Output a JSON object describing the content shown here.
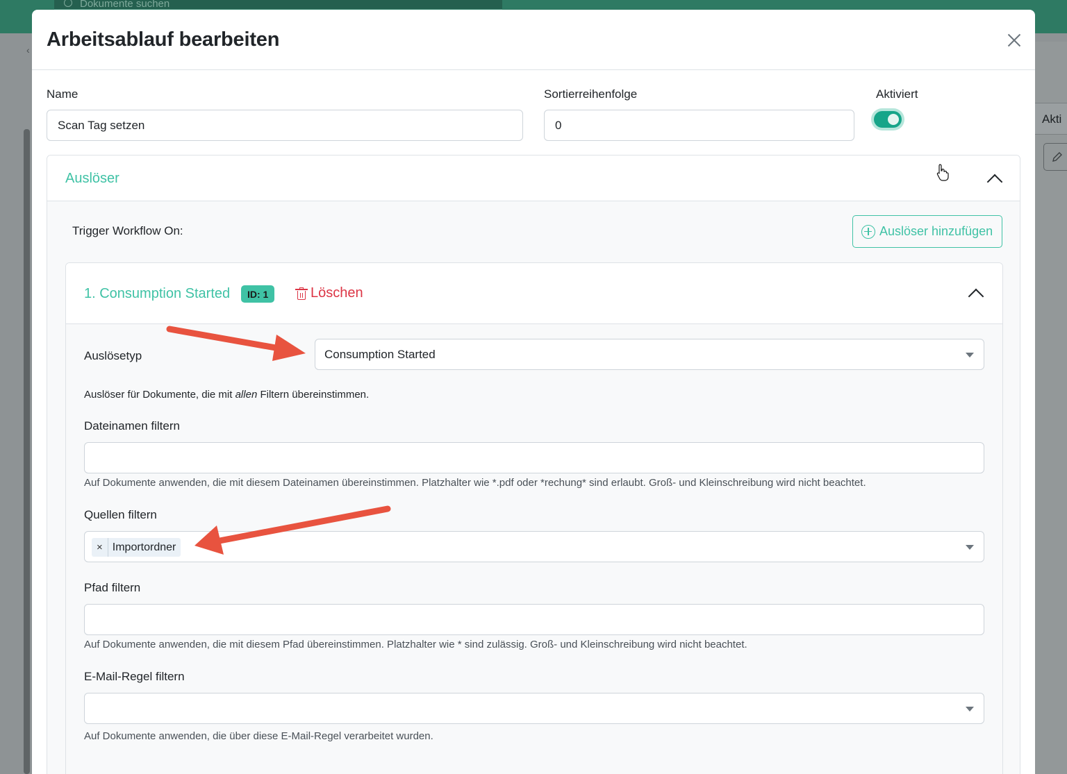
{
  "background": {
    "search_placeholder": "Dokumente suchen",
    "right_column_header": "Akti"
  },
  "modal": {
    "title": "Arbeitsablauf bearbeiten",
    "name_label": "Name",
    "name_value": "Scan Tag setzen",
    "sort_label": "Sortierreihenfolge",
    "sort_value": "0",
    "enabled_label": "Aktiviert",
    "enabled": true
  },
  "triggers": {
    "section_title": "Auslöser",
    "trigger_on_label": "Trigger Workflow On:",
    "add_button": "Auslöser hinzufügen",
    "item": {
      "title": "1. Consumption Started",
      "id_badge": "ID: 1",
      "delete_button": "Löschen",
      "type_label": "Auslösetyp",
      "type_value": "Consumption Started",
      "description_pre": "Auslöser für Dokumente, die mit ",
      "description_em": "allen",
      "description_post": " Filtern übereinstimmen.",
      "filename_label": "Dateinamen filtern",
      "filename_value": "",
      "filename_help": "Auf Dokumente anwenden, die mit diesem Dateinamen übereinstimmen. Platzhalter wie *.pdf oder *rechung* sind erlaubt. Groß- und Kleinschreibung wird nicht beachtet.",
      "sources_label": "Quellen filtern",
      "sources_tags": [
        "Importordner"
      ],
      "path_label": "Pfad filtern",
      "path_value": "",
      "path_help": "Auf Dokumente anwenden, die mit diesem Pfad übereinstimmen. Platzhalter wie * sind zulässig. Groß- und Kleinschreibung wird nicht beachtet.",
      "mailrule_label": "E-Mail-Regel filtern",
      "mailrule_value": "",
      "mailrule_help": "Auf Dokumente anwenden, die über diese E-Mail-Regel verarbeitet wurden."
    }
  },
  "colors": {
    "accent": "#3fc2a5",
    "danger": "#dc3545",
    "annotation_arrow": "#e8533f",
    "topbar": "#2e7a63"
  },
  "icons": [
    "close-icon",
    "chevron-up-icon",
    "plus-circle-icon",
    "trash-icon",
    "caret-down-icon",
    "pointer-cursor-icon",
    "pencil-icon",
    "search-icon"
  ]
}
